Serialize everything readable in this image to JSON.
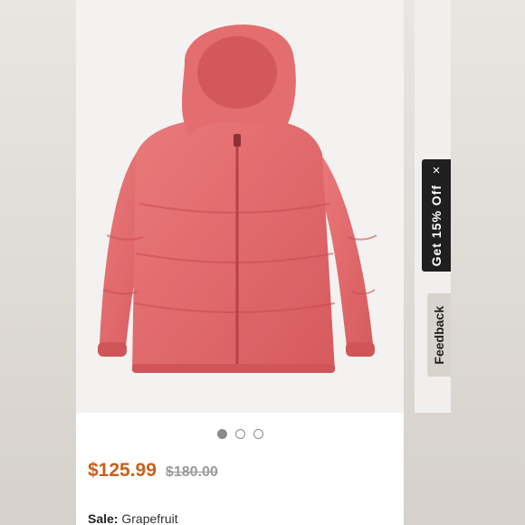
{
  "product": {
    "image_alt": "Pink hooded puffer jacket",
    "sale_price": "$125.99",
    "original_price": "$180.00",
    "sale_label": "Sale:",
    "color_value": "Grapefruit",
    "image_count": 3,
    "active_image": 1
  },
  "promo": {
    "label": "Get 15% Off",
    "close": "×"
  },
  "feedback": {
    "label": "Feedback"
  },
  "colors": {
    "jacket": "#e2676a",
    "sale_price": "#c8601b",
    "original_price": "#9a9a9a"
  }
}
